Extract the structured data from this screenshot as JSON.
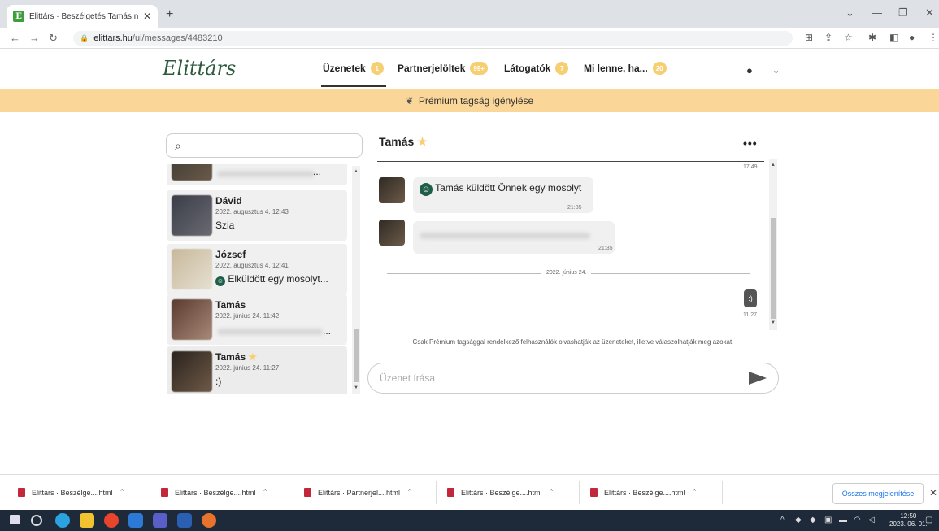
{
  "browser": {
    "tab_title": "Elittárs · Beszélgetés Tamás nevű",
    "url_host": "elittars.hu",
    "url_path": "/ui/messages/4483210"
  },
  "site": {
    "logo": "Elittárs",
    "nav": [
      {
        "label": "Üzenetek",
        "badge": "1"
      },
      {
        "label": "Partnerjelöltek",
        "badge": "99+"
      },
      {
        "label": "Látogatók",
        "badge": "7"
      },
      {
        "label": "Mi lenne, ha...",
        "badge": "20"
      }
    ],
    "premium_label": "Prémium tagság igénylése"
  },
  "conversations": [
    {
      "name": "",
      "date": "",
      "message": "..."
    },
    {
      "name": "Dávid",
      "date": "2022. augusztus 4. 12:43",
      "message": "Szia"
    },
    {
      "name": "József",
      "date": "2022. augusztus 4. 12:41",
      "message": "Elküldött egy mosolyt..."
    },
    {
      "name": "Tamás",
      "date": "2022. június 24. 11:42",
      "message": "..."
    },
    {
      "name": "Tamás",
      "date": "2022. június 24. 11:27",
      "message": ":)"
    }
  ],
  "chat": {
    "header_name": "Tamás",
    "more_label": "•••",
    "top_time": "17:49",
    "smile_message": "Tamás küldött Önnek egy mosolyt",
    "smile_time": "21:35",
    "blurred_time": "21:35",
    "day_separator": "2022. június 24.",
    "own_message": ":)",
    "own_time": "11:27",
    "notice": "Csak Prémium tagsággal rendelkező felhasználók olvashatják az üzeneteket, illetve válaszolhatják meg azokat.",
    "compose_placeholder": "Üzenet írása"
  },
  "downloads": {
    "items": [
      "Elittárs · Beszélge....html",
      "Elittárs · Beszélge....html",
      "Elittárs · Partnerjel....html",
      "Elittárs · Beszélge....html",
      "Elittárs · Beszélge....html"
    ],
    "show_all": "Összes megjelenítése"
  },
  "taskbar": {
    "time": "12:50",
    "date": "2023. 06. 01."
  },
  "colors": {
    "premium_bar": "#fbd699",
    "badge": "#f6cf72",
    "logo": "#2d5a3d"
  }
}
